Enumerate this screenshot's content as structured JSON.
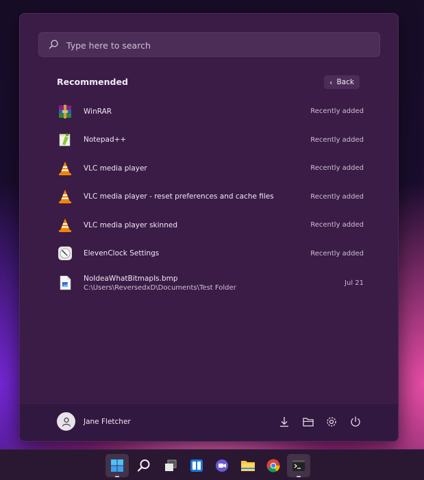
{
  "search": {
    "placeholder": "Type here to search"
  },
  "recommended": {
    "title": "Recommended",
    "back_label": "Back",
    "items": [
      {
        "name": "WinRAR",
        "icon": "winrar-icon",
        "right": "Recently added"
      },
      {
        "name": "Notepad++",
        "icon": "notepadpp-icon",
        "right": "Recently added"
      },
      {
        "name": "VLC media player",
        "icon": "vlc-icon",
        "right": "Recently added"
      },
      {
        "name": "VLC media player - reset preferences and cache files",
        "icon": "vlc-icon",
        "right": "Recently added"
      },
      {
        "name": "VLC media player skinned",
        "icon": "vlc-icon",
        "right": "Recently added"
      },
      {
        "name": "ElevenClock Settings",
        "icon": "elevenclock-icon",
        "right": "Recently added"
      },
      {
        "name": "NoIdeaWhatBitmapIs.bmp",
        "sub": "C:\\Users\\ReversedxD\\Documents\\Test Folder",
        "icon": "bitmap-file-icon",
        "right": "Jul 21"
      }
    ]
  },
  "footer": {
    "user_name": "Jane Fletcher",
    "icons": [
      "downloads-icon",
      "file-explorer-icon",
      "settings-icon",
      "power-icon"
    ]
  },
  "taskbar": {
    "items": [
      "start-icon",
      "search-icon",
      "task-view-icon",
      "widgets-icon",
      "chat-icon",
      "file-explorer-icon",
      "chrome-icon",
      "terminal-icon"
    ]
  },
  "colors": {
    "accent": "#0078d4",
    "panel": "#3a1c46",
    "vlc_orange": "#f28500"
  }
}
